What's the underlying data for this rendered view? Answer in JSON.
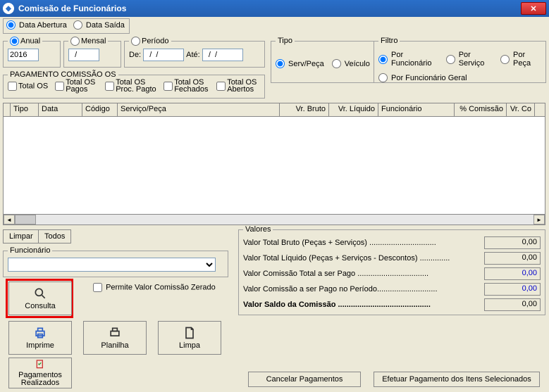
{
  "window": {
    "title": "Comissão de Funcionários"
  },
  "dateMode": {
    "abertura": "Data Abertura",
    "saida": "Data Saída"
  },
  "anual": {
    "label": "Anual",
    "value": "2016"
  },
  "mensal": {
    "label": "Mensal",
    "value": "  /"
  },
  "periodo": {
    "label": "Período",
    "de": "De:",
    "ate": "Até:",
    "deVal": "  /  /",
    "ateVal": "  /  /"
  },
  "tipo": {
    "legend": "Tipo",
    "servPeca": "Serv/Peça",
    "veiculo": "Veículo"
  },
  "filtro": {
    "legend": "Filtro",
    "porFunc": "Por Funcionário",
    "porServ": "Por Serviço",
    "porPeca": "Por Peça",
    "porFuncGeral": "Por Funcionário Geral"
  },
  "pagOS": {
    "legend": "PAGAMENTO COMISSÃO OS",
    "totalOS": "Total OS",
    "totalOSPagos": "Total OS Pagos",
    "totalOSProc": "Total OS Proc. Pagto",
    "totalOSFech": "Total OS Fechados",
    "totalOSAbert": "Total OS Abertos"
  },
  "columns": {
    "tipo": "Tipo",
    "data": "Data",
    "codigo": "Código",
    "servPeca": "Serviço/Peça",
    "vrBruto": "Vr. Bruto",
    "vrLiquido": "Vr. Líquido",
    "funcionario": "Funcionário",
    "pctCom": "% Comissão",
    "vrCo": "Vr. Co"
  },
  "buttons": {
    "limpar": "Limpar",
    "todos": "Todos",
    "consulta": "Consulta",
    "imprime": "Imprime",
    "planilha": "Planilha",
    "limpa": "Limpa",
    "pagRealizados": "Pagamentos Realizados",
    "cancelarPag": "Cancelar Pagamentos",
    "efetuarPag": "Efetuar Pagamento dos Itens Selecionados"
  },
  "funcionario": {
    "legend": "Funcionário"
  },
  "permiteZerado": "Permite Valor Comissão Zerado",
  "valores": {
    "legend": "Valores",
    "bruto": {
      "label": "Valor Total Bruto (Peças + Serviços) ...............................",
      "value": "0,00"
    },
    "liquido": {
      "label": "Valor Total Líquido (Peças + Serviços - Descontos) ..............",
      "value": "0,00"
    },
    "comTotal": {
      "label": "Valor Comissão Total a ser Pago .................................",
      "value": "0,00"
    },
    "comPeriodo": {
      "label": "Valor Comissão a ser Pago no Período............................",
      "value": "0,00"
    },
    "saldo": {
      "label": "Valor Saldo da Comissão ...........................................",
      "value": "0,00"
    }
  }
}
